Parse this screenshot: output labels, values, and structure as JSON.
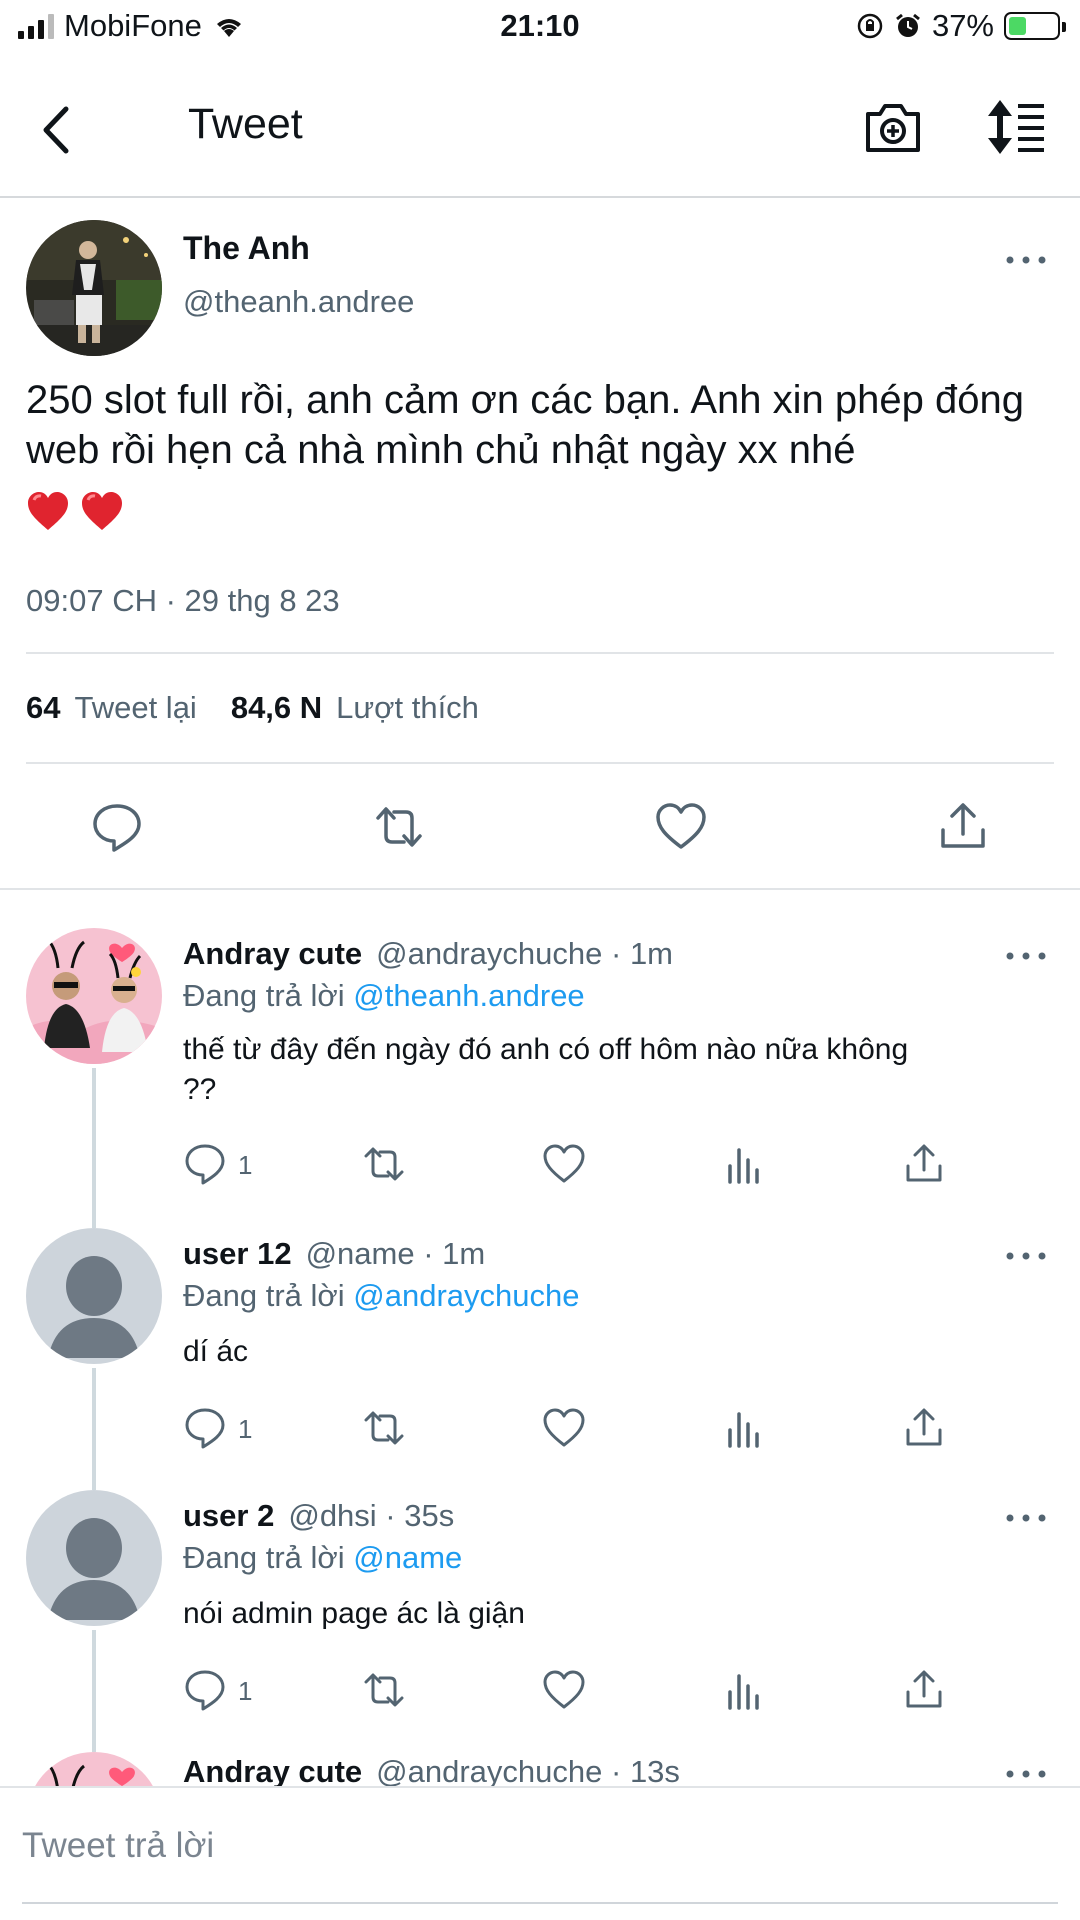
{
  "status_bar": {
    "carrier": "MobiFone",
    "time": "21:10",
    "battery": "37%",
    "battery_level": 0.37
  },
  "header": {
    "title": "Tweet",
    "icons": [
      "back-chevron-icon",
      "camera-plus-icon",
      "sort-timeline-icon"
    ]
  },
  "tweet": {
    "name": "The Anh",
    "handle": "@theanh.andree",
    "text": "250 slot full rồi, anh cảm ơn các bạn. Anh xin phép đóng web rồi hẹn cả nhà mình chủ nhật ngày xx nhé",
    "emoji": [
      "❤️",
      "❤️"
    ],
    "timestamp": "09:07 CH · 29 thg 8 23",
    "retweets": "64",
    "retweets_label": "Tweet lại",
    "likes": "84,6 N",
    "likes_label": "Lượt thích",
    "actions": [
      "reply-icon",
      "retweet-icon",
      "like-icon",
      "share-icon"
    ]
  },
  "replies": [
    {
      "name": "Andray cute",
      "meta": "@andraychuche · 1m",
      "replying_prefix": "Đang trả lời",
      "mention": "@theanh.andree",
      "text": "thế từ đây đến ngày đó anh có off hôm nào nữa không ??",
      "reply_count": "1"
    },
    {
      "name": "user 12",
      "meta": "@name · 1m",
      "replying_prefix": "Đang trả lời",
      "mention": "@andraychuche",
      "text": "dí ác",
      "reply_count": "1"
    },
    {
      "name": "user 2",
      "meta": "@dhsi · 35s",
      "replying_prefix": "Đang trả lời",
      "mention": "@name",
      "text": "nói admin page ác là giận",
      "reply_count": "1"
    },
    {
      "name": "Andray cute",
      "meta": "@andraychuche · 13s"
    }
  ],
  "composer": {
    "placeholder": "Tweet trả lời"
  },
  "colors": {
    "accent": "#1d9bf0",
    "text": "#0f1419",
    "muted": "#536471",
    "divider": "#e1e4e7"
  }
}
